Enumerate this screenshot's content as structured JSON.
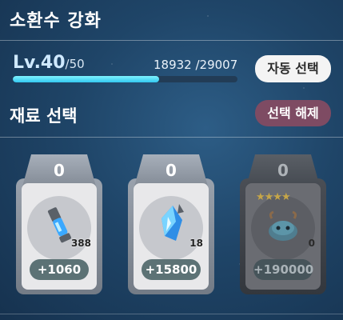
{
  "header": {
    "title": "소환수 강화"
  },
  "level": {
    "current": "Lv.40",
    "max": "/50",
    "xp_text": "18932 /29007",
    "xp_fraction": 0.653
  },
  "buttons": {
    "auto_select": "자동 선택",
    "deselect": "선택 해제"
  },
  "materials": {
    "title": "재료 선택",
    "cards": [
      {
        "count": "0",
        "quantity": "388",
        "bonus": "+1060",
        "icon": "crystal-scroll-icon",
        "enabled": true
      },
      {
        "count": "0",
        "quantity": "18",
        "bonus": "+15800",
        "icon": "crystal-shard-icon",
        "enabled": true
      },
      {
        "count": "0",
        "quantity": "0",
        "bonus": "+190000",
        "icon": "slime-summon-icon",
        "stars": "★★★★",
        "enabled": false
      }
    ]
  }
}
